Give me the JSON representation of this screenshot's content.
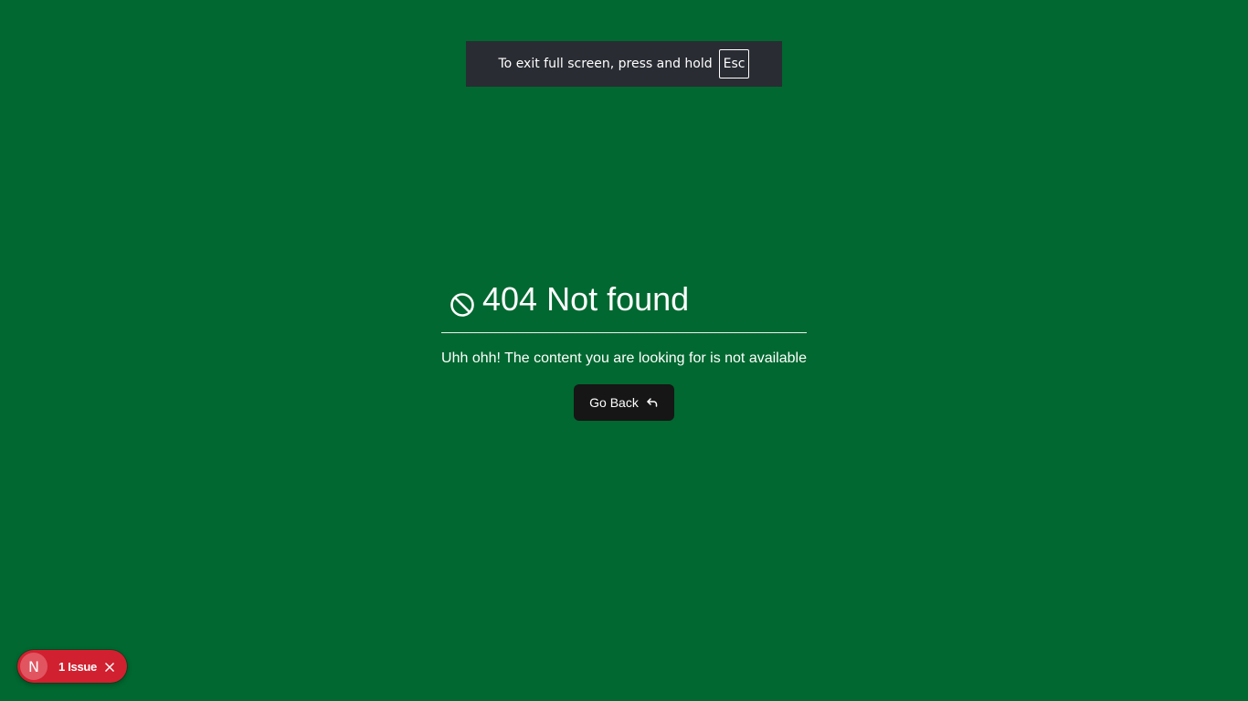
{
  "fullscreen_notice": {
    "text": "To exit full screen, press and hold",
    "key": "Esc"
  },
  "not_found": {
    "icon": "ban-icon",
    "title": "404 Not found",
    "message": "Uhh ohh! The content you are looking for is not available",
    "go_back_label": "Go Back",
    "go_back_icon": "back-arrow-icon"
  },
  "issues_badge": {
    "logo_letter": "N",
    "label": "1 Issue",
    "close_icon": "close-icon"
  },
  "colors": {
    "background": "#006830",
    "notice_background": "#2a2c33",
    "button_background": "#161616",
    "badge_background": "#d1202f"
  }
}
